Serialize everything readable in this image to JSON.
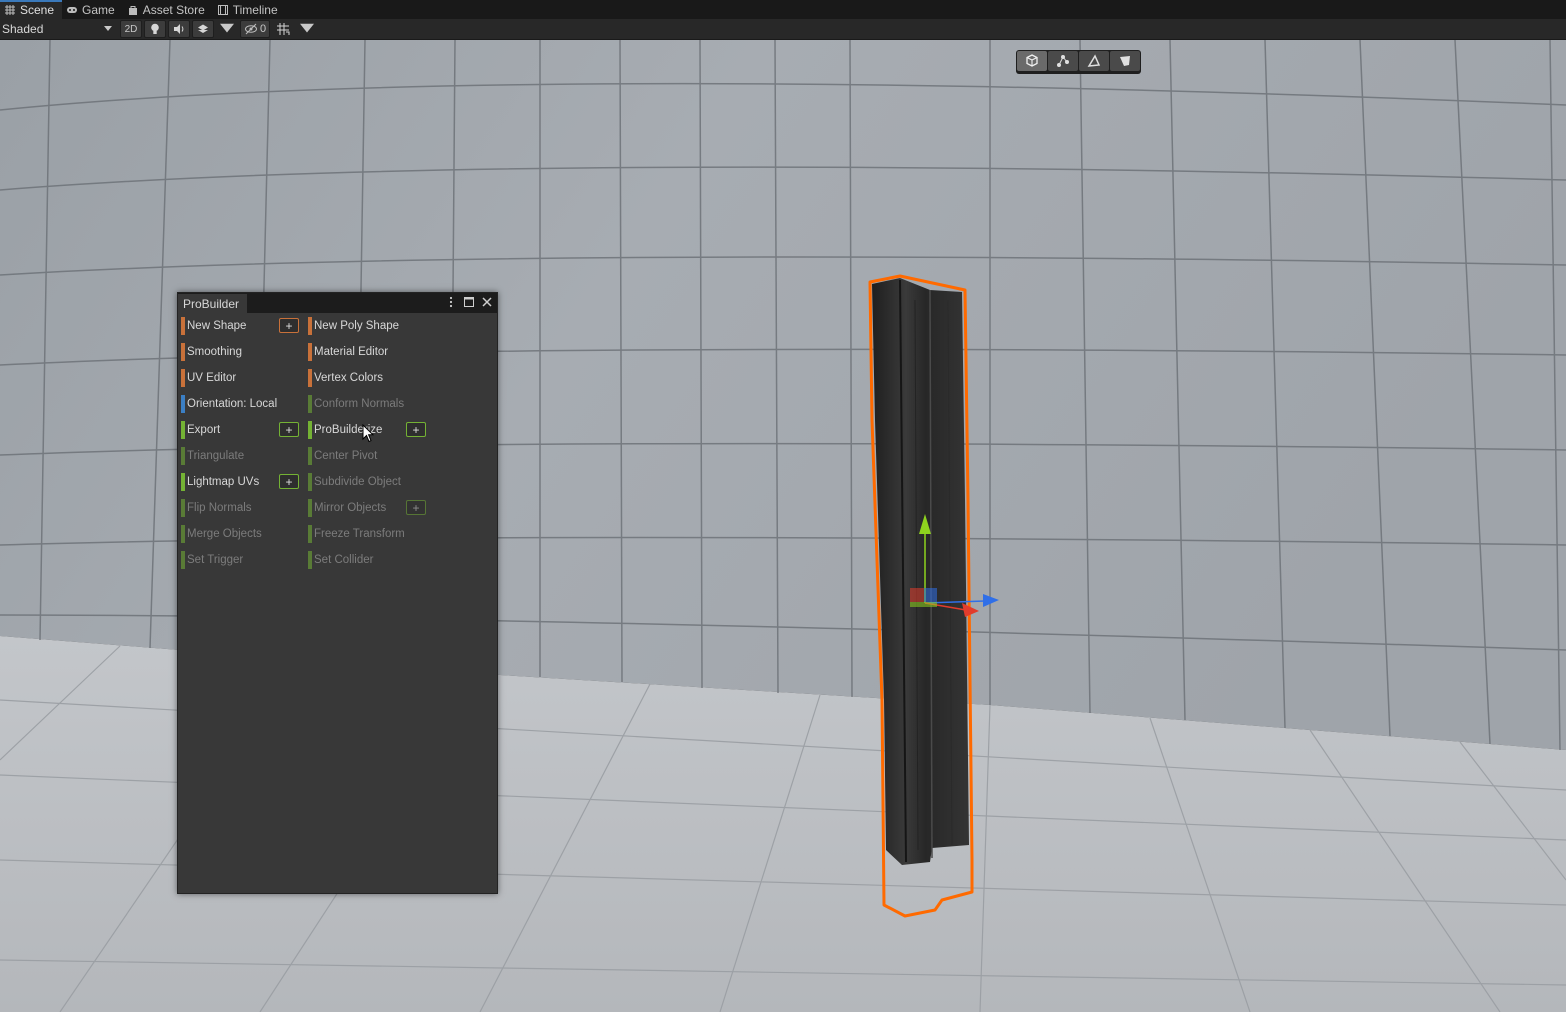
{
  "tabs": [
    {
      "label": "Scene",
      "icon": "grid-icon",
      "active": true
    },
    {
      "label": "Game",
      "icon": "gamepad-icon",
      "active": false
    },
    {
      "label": "Asset Store",
      "icon": "bag-icon",
      "active": false
    },
    {
      "label": "Timeline",
      "icon": "film-icon",
      "active": false
    }
  ],
  "toolbar": {
    "draw_mode": "Shaded",
    "toggle_2d": "2D",
    "hidden_count": "0"
  },
  "probuilder": {
    "title": "ProBuilder",
    "left_column": [
      {
        "label": "New Shape",
        "color": "#c8713a",
        "options": true,
        "enabled": true
      },
      {
        "label": "Smoothing",
        "color": "#c8713a",
        "options": false,
        "enabled": true
      },
      {
        "label": "UV Editor",
        "color": "#c8713a",
        "options": false,
        "enabled": true
      },
      {
        "label": "Orientation: Local",
        "color": "#3b7fc4",
        "options": false,
        "enabled": true
      },
      {
        "label": "Export",
        "color": "#74b234",
        "options": true,
        "enabled": true
      },
      {
        "label": "Triangulate",
        "color": "#74b234",
        "options": false,
        "enabled": false
      },
      {
        "label": "Lightmap UVs",
        "color": "#74b234",
        "options": true,
        "enabled": true
      },
      {
        "label": "Flip Normals",
        "color": "#74b234",
        "options": false,
        "enabled": false
      },
      {
        "label": "Merge Objects",
        "color": "#74b234",
        "options": false,
        "enabled": false
      },
      {
        "label": "Set Trigger",
        "color": "#74b234",
        "options": false,
        "enabled": false
      }
    ],
    "right_column": [
      {
        "label": "New Poly Shape",
        "color": "#c8713a",
        "options": false,
        "enabled": true
      },
      {
        "label": "Material Editor",
        "color": "#c8713a",
        "options": false,
        "enabled": true
      },
      {
        "label": "Vertex Colors",
        "color": "#c8713a",
        "options": false,
        "enabled": true
      },
      {
        "label": "Conform Normals",
        "color": "#74b234",
        "options": false,
        "enabled": false
      },
      {
        "label": "ProBuilderize",
        "color": "#74b234",
        "options": true,
        "enabled": true
      },
      {
        "label": "Center Pivot",
        "color": "#74b234",
        "options": false,
        "enabled": false
      },
      {
        "label": "Subdivide Object",
        "color": "#74b234",
        "options": false,
        "enabled": false
      },
      {
        "label": "Mirror Objects",
        "color": "#74b234",
        "options": true,
        "enabled": false
      },
      {
        "label": "Freeze Transform",
        "color": "#74b234",
        "options": false,
        "enabled": false
      },
      {
        "label": "Set Collider",
        "color": "#74b234",
        "options": false,
        "enabled": false
      }
    ],
    "plus_label": "+"
  },
  "edit_modes": [
    {
      "name": "object-mode-icon",
      "active": true
    },
    {
      "name": "vertex-mode-icon",
      "active": false
    },
    {
      "name": "edge-mode-icon",
      "active": false
    },
    {
      "name": "face-mode-icon",
      "active": false
    }
  ],
  "colors": {
    "selection_outline": "#ff6a00",
    "gizmo_x": "#e23c2c",
    "gizmo_y": "#8ed31e",
    "gizmo_z": "#2f6fe8"
  }
}
